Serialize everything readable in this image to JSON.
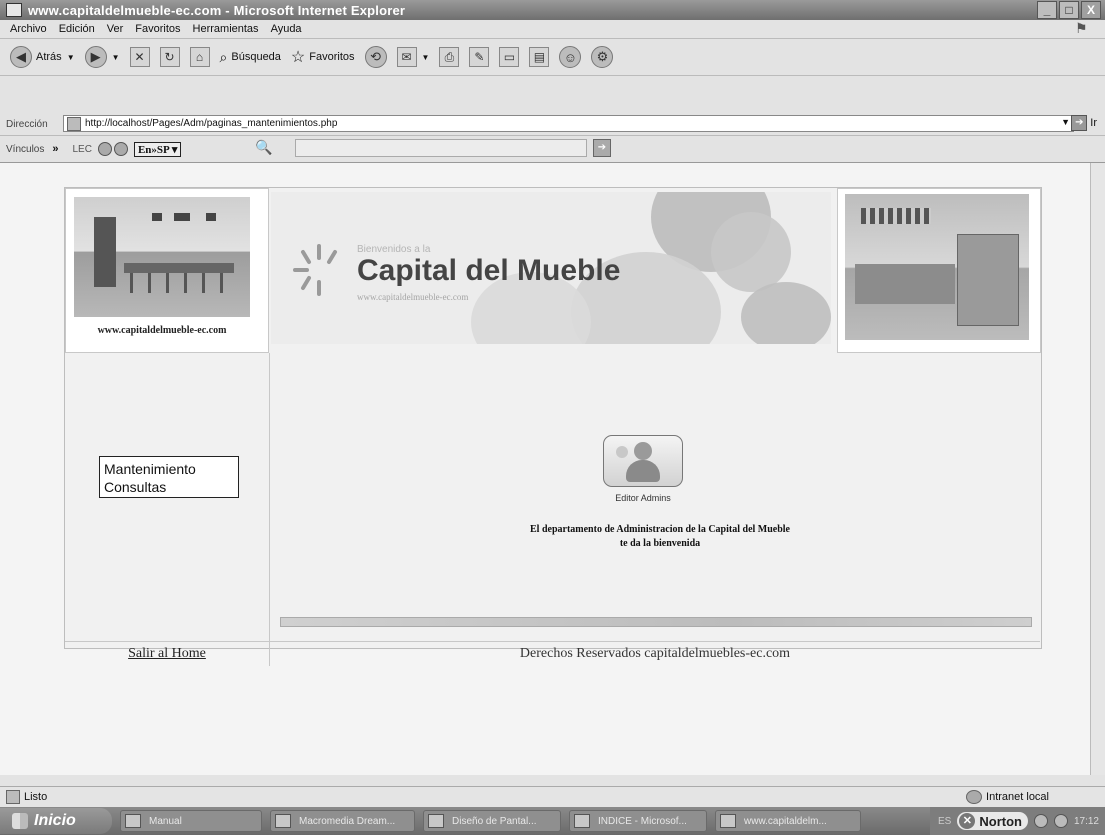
{
  "window": {
    "title": "www.capitaldelmueble-ec.com - Microsoft Internet Explorer",
    "min_label": "_",
    "max_label": "□",
    "close_label": "X"
  },
  "menu": {
    "items": [
      "Archivo",
      "Edición",
      "Ver",
      "Favoritos",
      "Herramientas",
      "Ayuda"
    ]
  },
  "toolbar": {
    "back_label": "Atrás",
    "search_label": "Búsqueda",
    "favorites_label": "Favoritos"
  },
  "address": {
    "label": "Dirección",
    "url": "http://localhost/Pages/Adm/paginas_mantenimientos.php",
    "go_label": "Ir"
  },
  "links": {
    "label": "Vínculos",
    "chevron": "»",
    "lec": "LEC",
    "translate": "En»SP ▾"
  },
  "page": {
    "site_caption": "www.capitaldelmueble-ec.com",
    "banner_welcome": "Bienvenidos a la",
    "banner_brand": "Capital del Mueble",
    "banner_url": "www.capitaldelmueble-ec.com",
    "menu_items": [
      "Mantenimiento",
      "Consultas"
    ],
    "editor_label": "Editor Admins",
    "welcome_line1": "El departamento de Administracion de la Capital del Mueble",
    "welcome_line2": "te da la bienvenida",
    "exit_link": "Salir al Home",
    "copyright": "Derechos Reservados capitaldelmuebles-ec.com"
  },
  "status": {
    "text": "Listo",
    "zone": "Intranet local"
  },
  "taskbar": {
    "start_label": "Inicio",
    "tasks": [
      "Manual",
      "Macromedia Dream...",
      "Diseño de Pantal...",
      "INDICE - Microsof...",
      "www.capitaldelm..."
    ],
    "lang": "ES",
    "norton": "Norton",
    "clock": "17:12"
  }
}
